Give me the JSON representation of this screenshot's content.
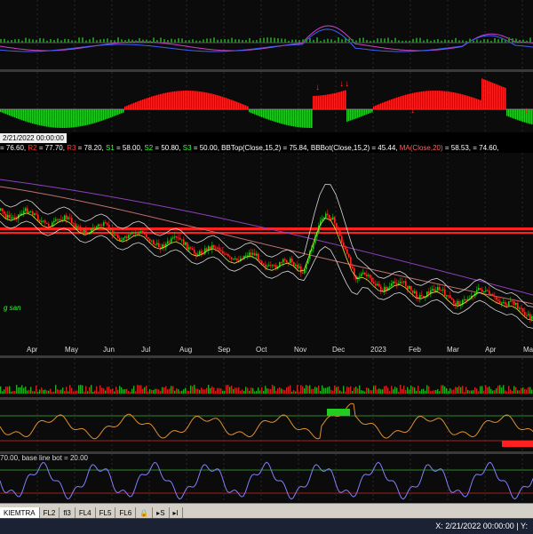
{
  "top_bar": {
    "status_label": "2/21/2022 00:00:00"
  },
  "legend_line": {
    "items": [
      {
        "text": "= 76.60, ",
        "color": "#ffffff"
      },
      {
        "text": "R2",
        "color": "#ff4040"
      },
      {
        "text": " = 77.70, ",
        "color": "#ffffff"
      },
      {
        "text": "R3",
        "color": "#ff4040"
      },
      {
        "text": " = 78.20, ",
        "color": "#ffffff"
      },
      {
        "text": "S1",
        "color": "#40ff40"
      },
      {
        "text": " = 58.00, ",
        "color": "#ffffff"
      },
      {
        "text": "S2",
        "color": "#40ff40"
      },
      {
        "text": " = 50.80, ",
        "color": "#ffffff"
      },
      {
        "text": "S3",
        "color": "#40ff40"
      },
      {
        "text": " = 50.00, BBTop(Close,15,2) = 75.84, BBBot(Close,15,2) = 45.44, ",
        "color": "#ffffff"
      },
      {
        "text": "MA(Close,20)",
        "color": "#ff6060"
      },
      {
        "text": " = 58.53,",
        "color": "#ffffff"
      },
      {
        "text": "          = 74.60, ",
        "color": "#ffffff"
      }
    ]
  },
  "price_chart": {
    "watermark": "g san",
    "x_labels": [
      "Apr",
      "May",
      "Jun",
      "Jul",
      "Aug",
      "Sep",
      "Oct",
      "Nov",
      "Dec",
      "2023",
      "Feb",
      "Mar",
      "Apr",
      "May"
    ]
  },
  "indicator_bottom": {
    "label": "70.00, base line bot = 20.00"
  },
  "tabs": [
    "KIEMTRA",
    "FL2",
    "fl3",
    "FL4",
    "FL5",
    "FL6"
  ],
  "tab_extras": [
    "▸S",
    "▸I"
  ],
  "status": {
    "coords": "X: 2/21/2022 00:00:00  |  Y:"
  },
  "colors": {
    "up": "#22cc22",
    "down": "#ff2a2a",
    "bb": "#d8d8d8",
    "ma": "#e0e040",
    "long_ma": "#9040c0"
  }
}
